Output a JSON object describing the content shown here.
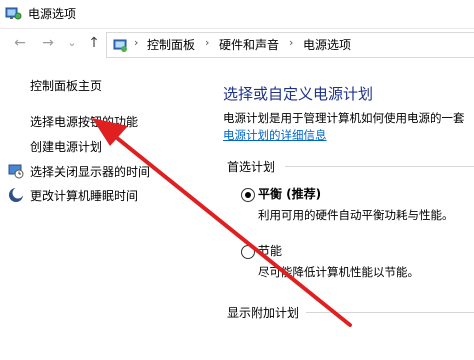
{
  "window": {
    "title": "电源选项"
  },
  "nav": {
    "back": "←",
    "forward": "→",
    "dropdown": "⌄",
    "up": "↑"
  },
  "breadcrumb": {
    "items": [
      "控制面板",
      "硬件和声音",
      "电源选项"
    ],
    "separator": "›"
  },
  "sidebar": {
    "items": [
      {
        "label": "控制面板主页"
      },
      {
        "label": "选择电源按钮的功能"
      },
      {
        "label": "创建电源计划"
      },
      {
        "label": "选择关闭显示器的时间"
      },
      {
        "label": "更改计算机睡眠时间"
      }
    ]
  },
  "main": {
    "heading": "选择或自定义电源计划",
    "description": "电源计划是用于管理计算机如何使用电源的一套",
    "details_link": "电源计划的详细信息",
    "preferred_label": "首选计划",
    "plans": [
      {
        "name": "平衡 (推荐)",
        "desc": "利用可用的硬件自动平衡功耗与性能。",
        "selected": true
      },
      {
        "name": "节能",
        "desc": "尽可能降低计算机性能以节能。",
        "selected": false
      }
    ],
    "additional_label": "显示附加计划"
  },
  "colors": {
    "heading": "#1e3287",
    "link": "#0066cc",
    "annotation_arrow": "#e02020"
  }
}
